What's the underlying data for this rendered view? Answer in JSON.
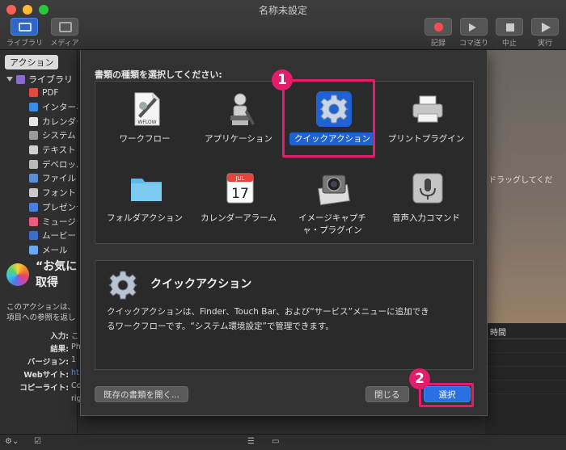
{
  "window": {
    "title": "名称未設定"
  },
  "toolbar": {
    "left": [
      {
        "label": "ライブラリ"
      },
      {
        "label": "メディア"
      }
    ],
    "right": [
      {
        "label": "記録"
      },
      {
        "label": "コマ送り"
      },
      {
        "label": "中止"
      },
      {
        "label": "実行"
      }
    ]
  },
  "sidebar": {
    "segment_label": "アクション",
    "root_label": "ライブラリ",
    "items": [
      {
        "label": "PDF",
        "color": "#e14b3b"
      },
      {
        "label": "インターネット",
        "color": "#3a8ee6"
      },
      {
        "label": "カレンダー",
        "color": "#e6e6e6"
      },
      {
        "label": "システム",
        "color": "#9a9a9a"
      },
      {
        "label": "テキスト",
        "color": "#cfcfcf"
      },
      {
        "label": "デベロッパ",
        "color": "#bbbbbb"
      },
      {
        "label": "ファイルとフォルダ",
        "color": "#5a8fd6"
      },
      {
        "label": "フォント",
        "color": "#c9c9c9"
      },
      {
        "label": "プレゼンテーション",
        "color": "#4a7fe0"
      },
      {
        "label": "ミュージック",
        "color": "#f05a7e"
      },
      {
        "label": "ムービー",
        "color": "#3c6ec8"
      },
      {
        "label": "メール",
        "color": "#6aa9f0"
      }
    ],
    "info": {
      "title_line1": "“お気に",
      "title_line2": "取得",
      "desc_line1": "このアクションは、",
      "desc_line2": "項目への参照を返し",
      "meta": [
        {
          "key": "入力:",
          "value": "こ"
        },
        {
          "key": "結果:",
          "value": "Ph"
        },
        {
          "key": "バージョン:",
          "value": "1"
        },
        {
          "key": "Webサイト:",
          "value": "ht",
          "link": true
        },
        {
          "key": "コピーライト:",
          "value": "Co"
        },
        {
          "key": "",
          "value": "rig"
        }
      ]
    }
  },
  "right_pane": {
    "hint": "ドラッグしてくだ",
    "log_header": "時間"
  },
  "dialog": {
    "prompt": "書類の種類を選択してください:",
    "types": [
      {
        "label": "ワークフロー",
        "icon": "workflow-document-icon"
      },
      {
        "label": "アプリケーション",
        "icon": "automator-robot-icon"
      },
      {
        "label": "クイックアクション",
        "icon": "gear-icon",
        "selected": true
      },
      {
        "label": "プリントプラグイン",
        "icon": "printer-icon"
      },
      {
        "label": "フォルダアクション",
        "icon": "folder-icon"
      },
      {
        "label": "カレンダーアラーム",
        "icon": "calendar-icon",
        "cal_month": "JUL",
        "cal_day": "17"
      },
      {
        "label": "イメージキャプチャ・プラグイン",
        "label_line1": "イメージキャプチ",
        "label_line2": "ャ・プラグイン",
        "icon": "camera-icon"
      },
      {
        "label": "音声入力コマンド",
        "icon": "microphone-icon"
      }
    ],
    "workflow_icon_text": "WFLOW",
    "description": {
      "title": "クイックアクション",
      "body_line1": "クイックアクションは、Finder、Touch Bar、および“サービス”メニューに追加でき",
      "body_line2": "るワークフローです。“システム環境設定”で管理できます。"
    },
    "buttons": {
      "open_existing": "既存の書類を開く...",
      "close": "閉じる",
      "choose": "選択"
    }
  },
  "annotations": {
    "step1": "1",
    "step2": "2",
    "highlight_color": "#e21d6b"
  }
}
